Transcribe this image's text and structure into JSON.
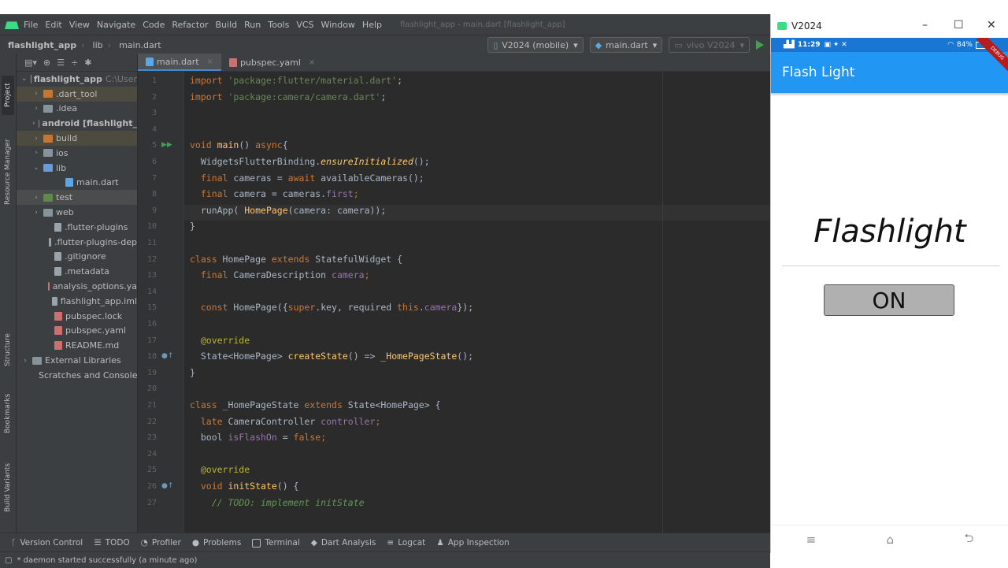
{
  "menubar": {
    "items": [
      "File",
      "Edit",
      "View",
      "Navigate",
      "Code",
      "Refactor",
      "Build",
      "Run",
      "Tools",
      "VCS",
      "Window",
      "Help"
    ],
    "window_title": "flashlight_app - main.dart [flashlight_app]"
  },
  "navbar": {
    "crumbs": [
      "flashlight_app",
      "lib",
      "main.dart"
    ],
    "device_combo": "V2024 (mobile)",
    "config_combo": "main.dart",
    "target_combo": "vivo V2024"
  },
  "side_tabs": {
    "project": "Project",
    "resource_manager": "Resource Manager",
    "structure": "Structure",
    "bookmarks": "Bookmarks",
    "build_variants": "Build Variants"
  },
  "project_tree": [
    {
      "label": "flashlight_app",
      "suffix": "C:\\User",
      "arrow": "v",
      "depth": 0,
      "icon": "dart",
      "style": "bold"
    },
    {
      "label": ".dart_tool",
      "suffix": "",
      "arrow": ">",
      "depth": 1,
      "icon": "folder-orange",
      "style": "tint"
    },
    {
      "label": ".idea",
      "suffix": "",
      "arrow": ">",
      "depth": 1,
      "icon": "folder",
      "style": ""
    },
    {
      "label": "android [flashlight_",
      "suffix": "",
      "arrow": ">",
      "depth": 1,
      "icon": "folder",
      "style": "bold"
    },
    {
      "label": "build",
      "suffix": "",
      "arrow": ">",
      "depth": 1,
      "icon": "folder-orange",
      "style": "tint"
    },
    {
      "label": "ios",
      "suffix": "",
      "arrow": ">",
      "depth": 1,
      "icon": "folder",
      "style": ""
    },
    {
      "label": "lib",
      "suffix": "",
      "arrow": "v",
      "depth": 1,
      "icon": "folder-blue",
      "style": ""
    },
    {
      "label": "main.dart",
      "suffix": "",
      "arrow": "",
      "depth": 3,
      "icon": "dart",
      "style": ""
    },
    {
      "label": "test",
      "suffix": "",
      "arrow": ">",
      "depth": 1,
      "icon": "folder-green",
      "style": "sel"
    },
    {
      "label": "web",
      "suffix": "",
      "arrow": ">",
      "depth": 1,
      "icon": "folder",
      "style": ""
    },
    {
      "label": ".flutter-plugins",
      "suffix": "",
      "arrow": "",
      "depth": 2,
      "icon": "file",
      "style": ""
    },
    {
      "label": ".flutter-plugins-dep",
      "suffix": "",
      "arrow": "",
      "depth": 2,
      "icon": "file",
      "style": ""
    },
    {
      "label": ".gitignore",
      "suffix": "",
      "arrow": "",
      "depth": 2,
      "icon": "file",
      "style": ""
    },
    {
      "label": ".metadata",
      "suffix": "",
      "arrow": "",
      "depth": 2,
      "icon": "file",
      "style": ""
    },
    {
      "label": "analysis_options.ya",
      "suffix": "",
      "arrow": "",
      "depth": 2,
      "icon": "yaml",
      "style": ""
    },
    {
      "label": "flashlight_app.iml",
      "suffix": "",
      "arrow": "",
      "depth": 2,
      "icon": "file",
      "style": ""
    },
    {
      "label": "pubspec.lock",
      "suffix": "",
      "arrow": "",
      "depth": 2,
      "icon": "yaml",
      "style": ""
    },
    {
      "label": "pubspec.yaml",
      "suffix": "",
      "arrow": "",
      "depth": 2,
      "icon": "yaml",
      "style": ""
    },
    {
      "label": "README.md",
      "suffix": "",
      "arrow": "",
      "depth": 2,
      "icon": "yaml",
      "style": ""
    },
    {
      "label": "External Libraries",
      "suffix": "",
      "arrow": ">",
      "depth": 0,
      "icon": "folder",
      "style": ""
    },
    {
      "label": "Scratches and Console",
      "suffix": "",
      "arrow": "",
      "depth": 1,
      "icon": "file",
      "style": ""
    }
  ],
  "tabs": [
    {
      "label": "main.dart",
      "active": true,
      "icon": "dart"
    },
    {
      "label": "pubspec.yaml",
      "active": false,
      "icon": "yaml"
    }
  ],
  "code": [
    {
      "n": "1",
      "g": "",
      "t": [
        [
          "kw",
          "import "
        ],
        [
          "st",
          "'package:flutter/material.dart'"
        ],
        [
          "",
          "; "
        ]
      ]
    },
    {
      "n": "2",
      "g": "",
      "t": [
        [
          "kw",
          "import "
        ],
        [
          "st",
          "'package:camera/camera.dart'"
        ],
        [
          "",
          ";"
        ]
      ]
    },
    {
      "n": "3",
      "g": "",
      "t": []
    },
    {
      "n": "4",
      "g": "",
      "t": []
    },
    {
      "n": "5",
      "g": "run",
      "t": [
        [
          "kw",
          "void "
        ],
        [
          "fn",
          "main"
        ],
        [
          "",
          "() "
        ],
        [
          "kw",
          "async"
        ],
        [
          "",
          "{"
        ]
      ]
    },
    {
      "n": "6",
      "g": "",
      "t": [
        [
          "",
          "  WidgetsFlutterBinding."
        ],
        [
          "fni",
          "ensureInitialized"
        ],
        [
          "",
          "();"
        ]
      ]
    },
    {
      "n": "7",
      "g": "",
      "t": [
        [
          "kw",
          "  final "
        ],
        [
          "",
          "cameras = "
        ],
        [
          "kw",
          "await "
        ],
        [
          "",
          "availableCameras();"
        ]
      ]
    },
    {
      "n": "8",
      "g": "",
      "t": [
        [
          "kw",
          "  final "
        ],
        [
          "",
          "camera = cameras."
        ],
        [
          "pv",
          "first"
        ],
        [
          "kw",
          ";"
        ]
      ]
    },
    {
      "n": "9",
      "g": "",
      "t": [
        [
          "",
          "  runApp( "
        ],
        [
          "fn",
          "HomePage"
        ],
        [
          "",
          "(camera: camera));"
        ]
      ]
    },
    {
      "n": "10",
      "g": "",
      "t": [
        [
          "",
          "}"
        ]
      ]
    },
    {
      "n": "11",
      "g": "",
      "t": []
    },
    {
      "n": "12",
      "g": "",
      "t": [
        [
          "kw",
          "class "
        ],
        [
          "",
          "HomePage "
        ],
        [
          "kw",
          "extends "
        ],
        [
          "",
          "StatefulWidget {"
        ]
      ]
    },
    {
      "n": "13",
      "g": "",
      "t": [
        [
          "kw",
          "  final "
        ],
        [
          "",
          "CameraDescription "
        ],
        [
          "pv",
          "camera"
        ],
        [
          "kw",
          ";"
        ]
      ]
    },
    {
      "n": "14",
      "g": "",
      "t": []
    },
    {
      "n": "15",
      "g": "",
      "t": [
        [
          "kw",
          "  const "
        ],
        [
          "",
          "HomePage({"
        ],
        [
          "kw",
          "super"
        ],
        [
          "",
          ".key, required "
        ],
        [
          "kw",
          "this"
        ],
        [
          "",
          "."
        ],
        [
          "pv",
          "camera"
        ],
        [
          "",
          "});"
        ]
      ]
    },
    {
      "n": "16",
      "g": "",
      "t": []
    },
    {
      "n": "17",
      "g": "",
      "t": [
        [
          "an",
          "  @override"
        ]
      ]
    },
    {
      "n": "18",
      "g": "ovr",
      "t": [
        [
          "",
          "  State<HomePage> "
        ],
        [
          "fn",
          "createState"
        ],
        [
          "",
          "() => "
        ],
        [
          "fn",
          "_HomePageState"
        ],
        [
          "",
          "();"
        ]
      ]
    },
    {
      "n": "19",
      "g": "",
      "t": [
        [
          "",
          "}"
        ]
      ]
    },
    {
      "n": "20",
      "g": "",
      "t": []
    },
    {
      "n": "21",
      "g": "",
      "t": [
        [
          "kw",
          "class "
        ],
        [
          "",
          "_HomePageState "
        ],
        [
          "kw",
          "extends "
        ],
        [
          "",
          "State<HomePage> {"
        ]
      ]
    },
    {
      "n": "22",
      "g": "",
      "t": [
        [
          "kw",
          "  late "
        ],
        [
          "",
          "CameraController "
        ],
        [
          "pv",
          "controller"
        ],
        [
          "kw",
          ";"
        ]
      ]
    },
    {
      "n": "23",
      "g": "",
      "t": [
        [
          "",
          "  bool "
        ],
        [
          "pv",
          "isFlashOn"
        ],
        [
          "",
          " = "
        ],
        [
          "kw",
          "false"
        ],
        [
          "kw",
          ";"
        ]
      ]
    },
    {
      "n": "24",
      "g": "",
      "t": []
    },
    {
      "n": "25",
      "g": "",
      "t": [
        [
          "an",
          "  @override"
        ]
      ]
    },
    {
      "n": "26",
      "g": "ovr",
      "t": [
        [
          "kw",
          "  void "
        ],
        [
          "fn",
          "initState"
        ],
        [
          "",
          "() {"
        ]
      ]
    },
    {
      "n": "27",
      "g": "",
      "t": [
        [
          "cm",
          "    // TODO: implement initState"
        ]
      ]
    }
  ],
  "bottom_tools": [
    "Version Control",
    "TODO",
    "Profiler",
    "Problems",
    "Terminal",
    "Dart Analysis",
    "Logcat",
    "App Inspection"
  ],
  "status_text": "* daemon started successfully (a minute ago)",
  "emulator": {
    "window_title": "V2024",
    "time": "11:29",
    "battery": "84%",
    "app_title": "Flash Light",
    "heading": "Flashlight",
    "button_label": "ON",
    "ribbon": "DEBUG"
  },
  "colors": {
    "ide_bg": "#2b2b2b",
    "panel_bg": "#3c3f41",
    "appbar": "#2196f3",
    "button_bg": "#b0b0b0"
  }
}
